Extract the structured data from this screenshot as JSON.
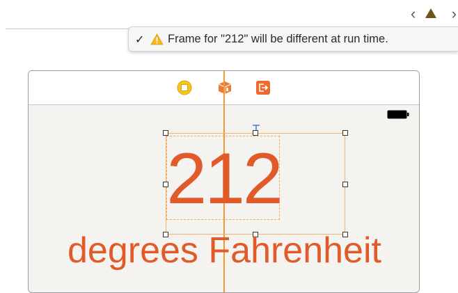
{
  "toolbar": {
    "prev_label": "‹",
    "next_label": "›"
  },
  "issue_popup": {
    "check": "✓",
    "message": "Frame for \"212\" will be different at run time."
  },
  "scene": {
    "temperature_value": "212",
    "unit_label": "degrees Fahrenheit"
  },
  "colors": {
    "accent": "#e05a2a",
    "guide": "#f39a2c",
    "warning": "#f5b819"
  }
}
